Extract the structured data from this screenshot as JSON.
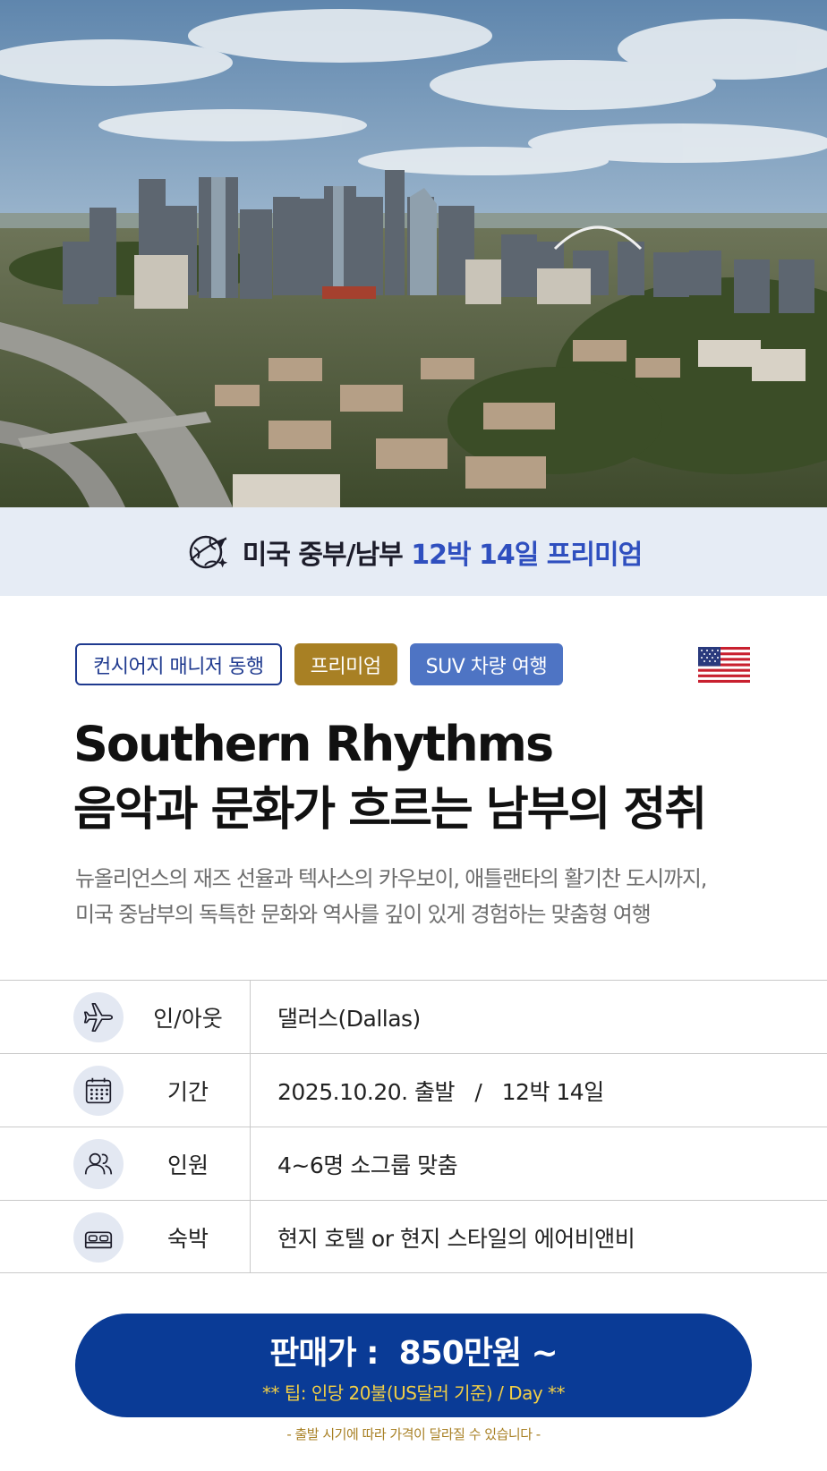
{
  "banner": {
    "text_dark": "미국 중부/남부 ",
    "text_blue": "12박 14일 프리미엄"
  },
  "tags": [
    {
      "label": "컨시어지 매니저 동행"
    },
    {
      "label": "프리미엄"
    },
    {
      "label": "SUV 차량 여행"
    }
  ],
  "title": {
    "en": "Southern Rhythms",
    "ko": "음악과 문화가 흐르는 남부의 정취"
  },
  "description": {
    "line1": "뉴올리언스의 재즈 선율과 텍사스의 카우보이, 애틀랜타의 활기찬 도시까지,",
    "line2": "미국 중남부의 독특한 문화와 역사를 깊이 있게 경험하는 맞춤형 여행"
  },
  "info": [
    {
      "icon": "airplane-icon",
      "label": "인/아웃",
      "value": "댈러스(Dallas)"
    },
    {
      "icon": "calendar-icon",
      "label": "기간",
      "value": "2025.10.20. 출발   /   12박 14일"
    },
    {
      "icon": "people-icon",
      "label": "인원",
      "value": "4~6명 소그룹 맞춤"
    },
    {
      "icon": "bed-icon",
      "label": "숙박",
      "value": "현지 호텔 or 현지 스타일의 에어비앤비"
    }
  ],
  "price": {
    "main": "판매가 :  850만원 ~",
    "tip": "** 팁: 인당 20불(US달러 기준) / Day **"
  },
  "note": "- 출발 시기에 따라 가격이 달라질 수 있습니다 -",
  "colors": {
    "navy": "#0a3b96",
    "gold": "#a88024",
    "tag_blue": "#4e74c4",
    "banner_bg": "#e6ecf5",
    "banner_accent": "#2f4fbf",
    "tip_yellow": "#f2cf45"
  }
}
